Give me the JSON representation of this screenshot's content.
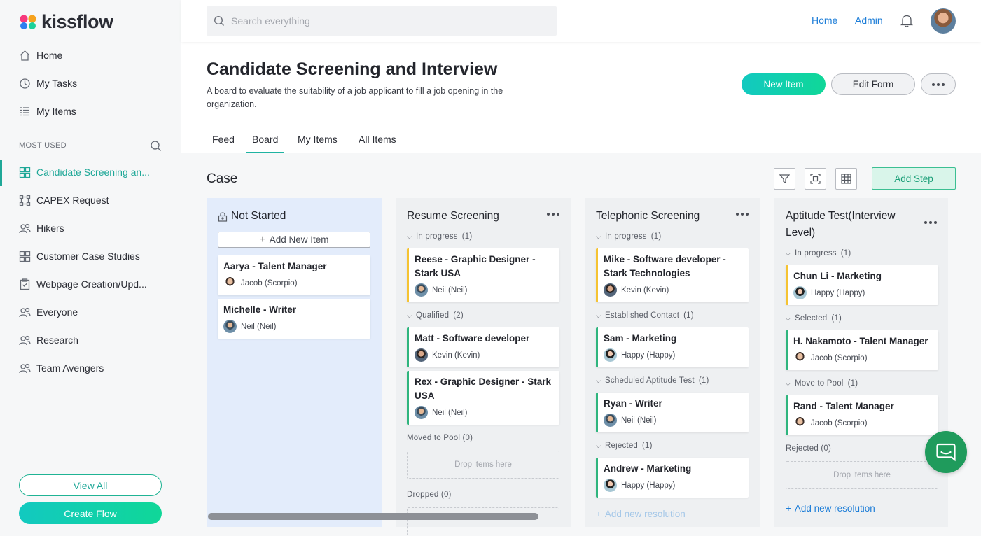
{
  "app": {
    "logo_text": "kissflow"
  },
  "sidebar": {
    "nav": [
      {
        "label": "Home",
        "icon": "home-icon"
      },
      {
        "label": "My Tasks",
        "icon": "clock-icon"
      },
      {
        "label": "My Items",
        "icon": "list-icon"
      }
    ],
    "section_label": "MOST USED",
    "items": [
      {
        "label": "Candidate Screening an...",
        "icon": "board-icon",
        "active": true
      },
      {
        "label": "CAPEX Request",
        "icon": "process-icon"
      },
      {
        "label": "Hikers",
        "icon": "users-icon"
      },
      {
        "label": "Customer Case Studies",
        "icon": "board-icon"
      },
      {
        "label": "Webpage Creation/Upd...",
        "icon": "clipboard-icon"
      },
      {
        "label": "Everyone",
        "icon": "users-icon"
      },
      {
        "label": "Research",
        "icon": "users-icon"
      },
      {
        "label": "Team Avengers",
        "icon": "users-icon"
      }
    ],
    "view_all": "View All",
    "create_flow": "Create Flow"
  },
  "topbar": {
    "search_placeholder": "Search everything",
    "links": [
      "Home",
      "Admin"
    ]
  },
  "header": {
    "title": "Candidate Screening and Interview",
    "description": "A board to evaluate the suitability of a job applicant to fill a job opening in the organization.",
    "new_item": "New Item",
    "edit_form": "Edit Form"
  },
  "tabs": [
    "Feed",
    "Board",
    "My Items",
    "All Items"
  ],
  "active_tab": "Board",
  "board": {
    "title": "Case",
    "add_step": "Add Step",
    "columns": [
      {
        "title": "Not Started",
        "add_new_item": "Add New Item",
        "cards": [
          {
            "title": "Aarya - Talent Manager",
            "user": "Jacob (Scorpio)"
          },
          {
            "title": "Michelle - Writer",
            "user": "Neil (Neil)"
          }
        ]
      },
      {
        "title": "Resume Screening",
        "groups": [
          {
            "label": "In progress",
            "count": "(1)"
          },
          {
            "label": "Qualified",
            "count": "(2)"
          },
          {
            "label": "Moved to Pool",
            "count": "(0)"
          },
          {
            "label": "Dropped",
            "count": "(0)"
          }
        ],
        "cards": [
          {
            "title": "Reese - Graphic Designer - Stark USA",
            "user": "Neil (Neil)"
          },
          {
            "title": "Matt - Software developer",
            "user": "Kevin (Kevin)"
          },
          {
            "title": "Rex - Graphic Designer - Stark USA",
            "user": "Neil (Neil)"
          }
        ],
        "drop_text": "Drop items here"
      },
      {
        "title": "Telephonic Screening",
        "groups": [
          {
            "label": "In progress",
            "count": "(1)"
          },
          {
            "label": "Established Contact",
            "count": "(1)"
          },
          {
            "label": "Scheduled Aptitude Test",
            "count": "(1)"
          },
          {
            "label": "Rejected",
            "count": "(1)"
          }
        ],
        "cards": [
          {
            "title": "Mike - Software developer - Stark Technologies",
            "user": "Kevin (Kevin)"
          },
          {
            "title": "Sam - Marketing",
            "user": "Happy (Happy)"
          },
          {
            "title": "Ryan - Writer",
            "user": "Neil (Neil)"
          },
          {
            "title": "Andrew - Marketing",
            "user": "Happy (Happy)"
          }
        ],
        "add_resolution": "Add new resolution"
      },
      {
        "title": "Aptitude Test(Interview Level)",
        "groups": [
          {
            "label": "In progress",
            "count": "(1)"
          },
          {
            "label": "Selected",
            "count": "(1)"
          },
          {
            "label": "Move to Pool",
            "count": "(1)"
          },
          {
            "label": "Rejected",
            "count": "(0)"
          }
        ],
        "cards": [
          {
            "title": "Chun Li - Marketing",
            "user": "Happy (Happy)"
          },
          {
            "title": "H. Nakamoto - Talent Manager",
            "user": "Jacob (Scorpio)"
          },
          {
            "title": "Rand - Talent Manager",
            "user": "Jacob (Scorpio)"
          }
        ],
        "drop_text": "Drop items here",
        "add_resolution": "Add new resolution"
      }
    ]
  },
  "colors": {
    "accent": "#1fa898",
    "link": "#1e7ed8",
    "in_progress": "#f5c332",
    "resolved": "#2fb57e",
    "chat": "#1f9b5c"
  }
}
